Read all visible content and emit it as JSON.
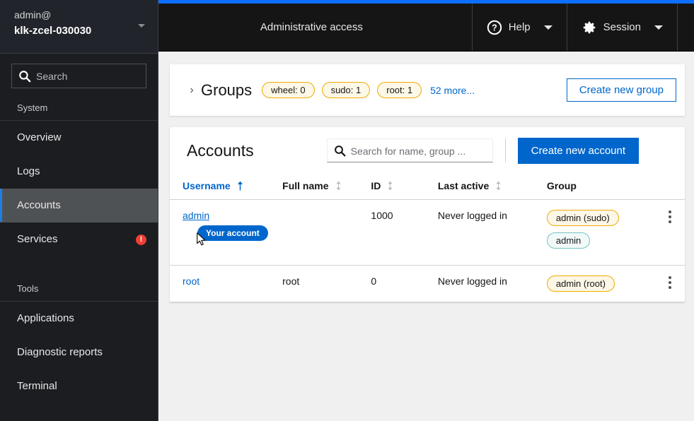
{
  "sidebar": {
    "account": {
      "user": "admin@",
      "host": "klk-zcel-030030",
      "caret_icon": "chevron-down-icon"
    },
    "search": {
      "placeholder": "Search",
      "icon": "search-icon",
      "value": ""
    },
    "groups": [
      {
        "label": "System",
        "items": [
          {
            "label": "Overview",
            "selected": false,
            "alert": ""
          },
          {
            "label": "Logs",
            "selected": false,
            "alert": ""
          },
          {
            "label": "Accounts",
            "selected": true,
            "alert": ""
          },
          {
            "label": "Services",
            "selected": false,
            "alert": "!"
          }
        ]
      },
      {
        "label": "Tools",
        "items": [
          {
            "label": "Applications",
            "selected": false,
            "alert": ""
          },
          {
            "label": "Diagnostic reports",
            "selected": false,
            "alert": ""
          },
          {
            "label": "Terminal",
            "selected": false,
            "alert": ""
          }
        ]
      }
    ]
  },
  "header": {
    "admin_access": "Administrative access",
    "help": {
      "label": "Help",
      "icon": "help-circle-icon",
      "caret_icon": "caret-down-icon"
    },
    "session": {
      "label": "Session",
      "icon": "gear-icon",
      "caret_icon": "caret-down-icon"
    },
    "accent_color": "#0d6efd"
  },
  "groups_card": {
    "expander_icon": "chevron-right-icon",
    "title": "Groups",
    "badges": [
      {
        "label": "wheel: 0"
      },
      {
        "label": "sudo: 1"
      },
      {
        "label": "root: 1"
      }
    ],
    "more_link": "52 more...",
    "create_button": "Create new group"
  },
  "accounts_card": {
    "title": "Accounts",
    "search": {
      "placeholder": "Search for name, group ...",
      "icon": "search-icon",
      "value": ""
    },
    "create_button": "Create new account",
    "columns": [
      {
        "label": "Username",
        "sorted": true,
        "sort_icon": "sort-asc-icon"
      },
      {
        "label": "Full name",
        "sorted": false,
        "sort_icon": "sort-icon"
      },
      {
        "label": "ID",
        "sorted": false,
        "sort_icon": "sort-icon"
      },
      {
        "label": "Last active",
        "sorted": false,
        "sort_icon": "sort-icon"
      },
      {
        "label": "Group",
        "sorted": false,
        "sort_icon": ""
      }
    ],
    "rows": [
      {
        "username": "admin",
        "username_hovered": true,
        "your_account_badge": "Your account",
        "full_name": "",
        "id": "1000",
        "last_active": "Never logged in",
        "groups": [
          {
            "label": "admin (sudo)",
            "style": "warning"
          },
          {
            "label": "admin",
            "style": "cyan"
          }
        ],
        "kebab_icon": "kebab-menu-icon"
      },
      {
        "username": "root",
        "username_hovered": false,
        "your_account_badge": "",
        "full_name": "root",
        "id": "0",
        "last_active": "Never logged in",
        "groups": [
          {
            "label": "admin (root)",
            "style": "warning"
          }
        ],
        "kebab_icon": "kebab-menu-icon"
      }
    ]
  },
  "colors": {
    "accent_blue": "#0066cc",
    "link_blue": "#06c",
    "sidebar_bg": "#1b1d21",
    "header_bg": "#151515",
    "selected_nav": "#4f5255",
    "alert_red": "#ee3f35",
    "warning_pill_bg": "#fdf7e7",
    "warning_pill_border": "#f0ab00",
    "cyan_pill_bg": "#f2f9f9",
    "cyan_pill_border": "#73c5c5",
    "page_bg": "#f0f0f0"
  }
}
